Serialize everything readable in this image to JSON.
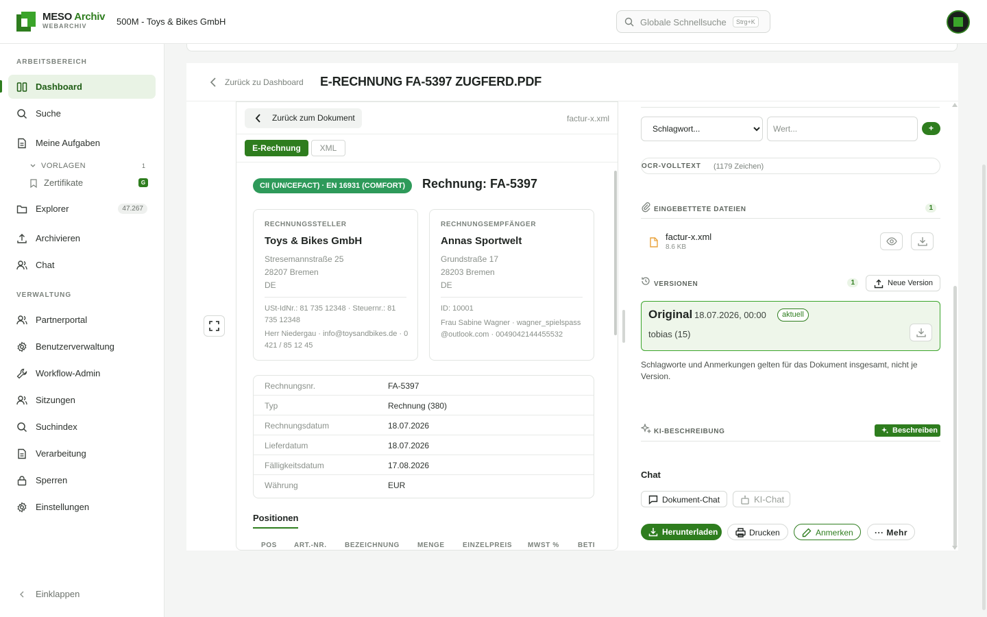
{
  "brand": {
    "name": "MESO",
    "name_accent": "Archiv",
    "sub": "WEBARCHIV"
  },
  "tenant": "500M - Toys & Bikes GmbH",
  "search": {
    "placeholder": "Globale Schnellsuche",
    "shortcut": "Strg+K"
  },
  "sidebar": {
    "section_work": "ARBEITSBEREICH",
    "section_admin": "VERWALTUNG",
    "items": [
      {
        "label": "Dashboard",
        "icon": "columns-icon"
      },
      {
        "label": "Suche",
        "icon": "search-icon"
      },
      {
        "label": "Meine Aufgaben",
        "icon": "document-icon"
      },
      {
        "label": "Explorer",
        "icon": "folder-icon",
        "count": "47.267"
      },
      {
        "label": "Archivieren",
        "icon": "upload-icon"
      },
      {
        "label": "Chat",
        "icon": "users-icon"
      }
    ],
    "templates": {
      "label": "VORLAGEN",
      "count": "1",
      "child": "Zertifikate",
      "child_badge": "G"
    },
    "admin_items": [
      {
        "label": "Partnerportal",
        "icon": "users-icon"
      },
      {
        "label": "Benutzerverwaltung",
        "icon": "gear-icon"
      },
      {
        "label": "Workflow-Admin",
        "icon": "wrench-icon"
      },
      {
        "label": "Sitzungen",
        "icon": "users-icon"
      },
      {
        "label": "Suchindex",
        "icon": "search-icon"
      },
      {
        "label": "Verarbeitung",
        "icon": "document-icon"
      },
      {
        "label": "Sperren",
        "icon": "lock-icon"
      },
      {
        "label": "Einstellungen",
        "icon": "gear-icon"
      }
    ],
    "collapse": "Einklappen"
  },
  "header": {
    "back": "Zurück zu Dashboard",
    "title": "E-RECHNUNG FA-5397 ZUGFERD.PDF"
  },
  "viewer": {
    "back": "Zurück zum Dokument",
    "file": "factur-x.xml",
    "tabs": [
      "E-Rechnung",
      "XML"
    ],
    "badge": "CII (UN/CEFACT) · EN 16931 (COMFORT)",
    "title": "Rechnung: FA-5397",
    "seller": {
      "role": "RECHNUNGSSTELLER",
      "name": "Toys & Bikes GmbH",
      "street": "Stresemannstraße 25",
      "city": "28207 Bremen",
      "country": "DE",
      "tax": "USt-IdNr.: 81 735 12348 · Steuernr.: 81 735 12348",
      "contact": "Herr Niedergau · info@toysandbikes.de · 0421 / 85 12 45"
    },
    "buyer": {
      "role": "RECHNUNGSEMPFÄNGER",
      "name": "Annas Sportwelt",
      "street": "Grundstraße 17",
      "city": "28203 Bremen",
      "country": "DE",
      "id": "ID: 10001",
      "contact": "Frau Sabine Wagner · wagner_spielspass@outlook.com · 0049042144455532"
    },
    "details": [
      {
        "k": "Rechnungsnr.",
        "v": "FA-5397"
      },
      {
        "k": "Typ",
        "v": "Rechnung (380)"
      },
      {
        "k": "Rechnungsdatum",
        "v": "18.07.2026"
      },
      {
        "k": "Lieferdatum",
        "v": "18.07.2026"
      },
      {
        "k": "Fälligkeitsdatum",
        "v": "17.08.2026"
      },
      {
        "k": "Währung",
        "v": "EUR"
      }
    ],
    "positions_title": "Positionen",
    "columns": [
      "POS",
      "ART.-NR.",
      "BEZEICHNUNG",
      "MENGE",
      "EINZELPREIS",
      "MWST %",
      "BETRAG"
    ]
  },
  "panel": {
    "keyword_select": "Schlagwort...",
    "value_placeholder": "Wert...",
    "add": "+",
    "ocr_label": "OCR-VOLLTEXT",
    "ocr_count": "(1179 Zeichen)",
    "embedded_label": "EINGEBETTETE DATEIEN",
    "embedded_count": "1",
    "file_name": "factur-x.xml",
    "file_size": "8.6 KB",
    "versions_label": "VERSIONEN",
    "versions_count": "1",
    "new_version": "Neue Version",
    "version": {
      "name": "Original",
      "date": "18.07.2026, 00:00",
      "badge": "aktuell",
      "user": "tobias (15)"
    },
    "note": "Schlagworte und Anmerkungen gelten für das Dokument insgesamt, nicht je Version.",
    "ai_label": "KI-BESCHREIBUNG",
    "ai_button": "Beschreiben",
    "chat_title": "Chat",
    "chat_buttons": [
      "Dokument-Chat",
      "KI-Chat"
    ],
    "actions": [
      "Herunterladen",
      "Drucken",
      "Anmerken",
      "··· Mehr"
    ]
  },
  "colors": {
    "accent": "#2e7d1e",
    "accent_light": "#e9f3e5",
    "badge_green": "#2e9a5a"
  }
}
